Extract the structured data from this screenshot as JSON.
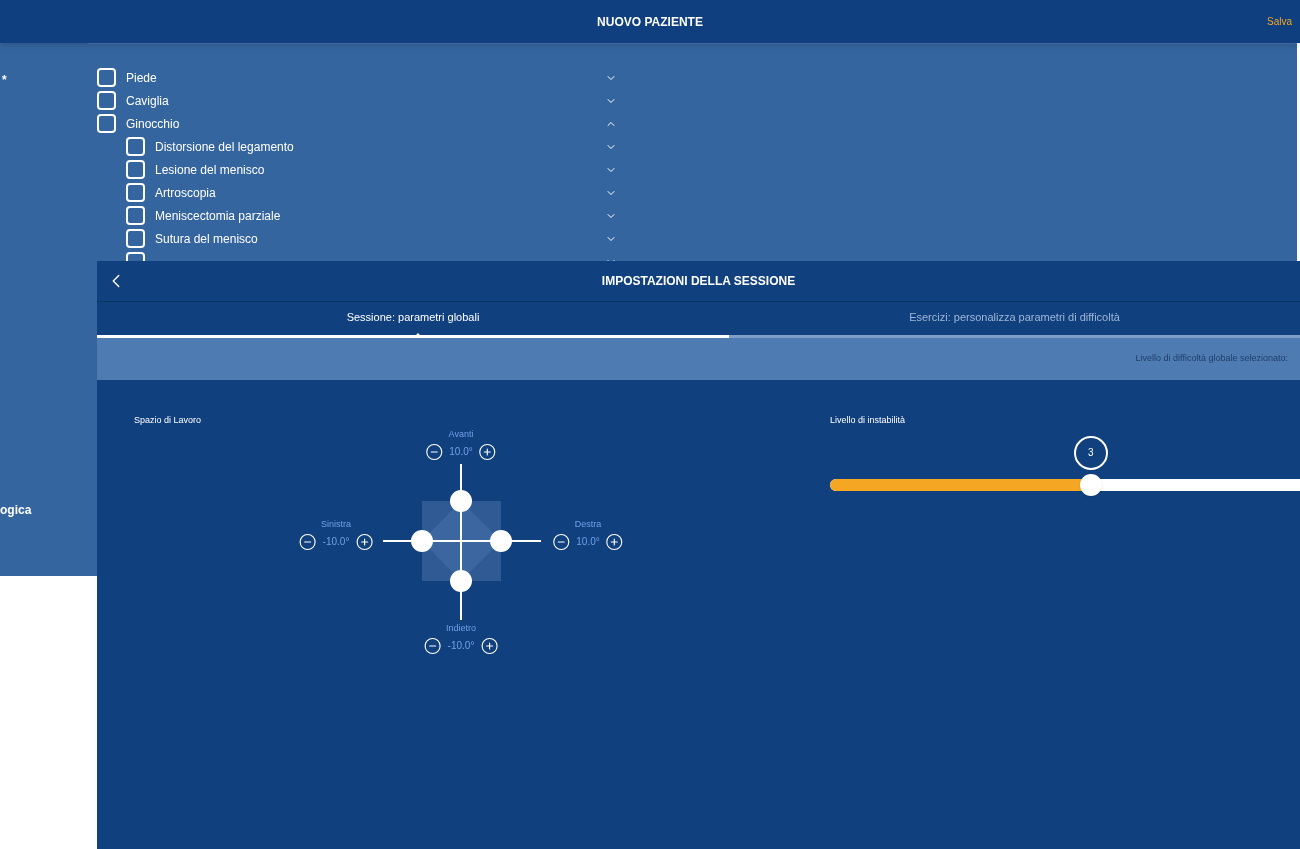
{
  "header": {
    "title": "NUOVO PAZIENTE",
    "save": "Salva"
  },
  "background_form": {
    "labels": [
      "*",
      "ogica"
    ],
    "tree": [
      {
        "label": "Piede",
        "checked": false,
        "expanded": false
      },
      {
        "label": "Caviglia",
        "checked": false,
        "expanded": false
      },
      {
        "label": "Ginocchio",
        "checked": false,
        "expanded": true,
        "children": [
          {
            "label": "Distorsione del legamento",
            "checked": false,
            "expanded": false
          },
          {
            "label": "Lesione del menisco",
            "checked": false,
            "expanded": false
          },
          {
            "label": "Artroscopia",
            "checked": false,
            "expanded": false
          },
          {
            "label": "Meniscectomia parziale",
            "checked": false,
            "expanded": false
          },
          {
            "label": "Sutura del menisco",
            "checked": false,
            "expanded": false
          },
          {
            "checked": false,
            "expanded": false
          }
        ]
      }
    ]
  },
  "dialog": {
    "title": "IMPOSTAZIONI DELLA SESSIONE",
    "tabs": [
      {
        "label": "Sessione: parametri globali",
        "selected": true
      },
      {
        "label": "Esercizi: personalizza parametri di difficoltà",
        "selected": false
      }
    ],
    "info_bar": "Livello di difficoltà globale selezionato:",
    "workspace": {
      "title": "Spazio di Lavoro",
      "directions": [
        {
          "kind": "up",
          "label": "Avanti",
          "value": "10.0°"
        },
        {
          "kind": "left",
          "label": "Sinistra",
          "value": "-10.0°"
        },
        {
          "kind": "right",
          "label": "Destra",
          "value": "10.0°"
        },
        {
          "kind": "down",
          "label": "Indietro",
          "value": "-10.0°"
        }
      ]
    },
    "instability": {
      "title": "Livello di instabilità",
      "value": "3",
      "level": 0.555
    }
  }
}
